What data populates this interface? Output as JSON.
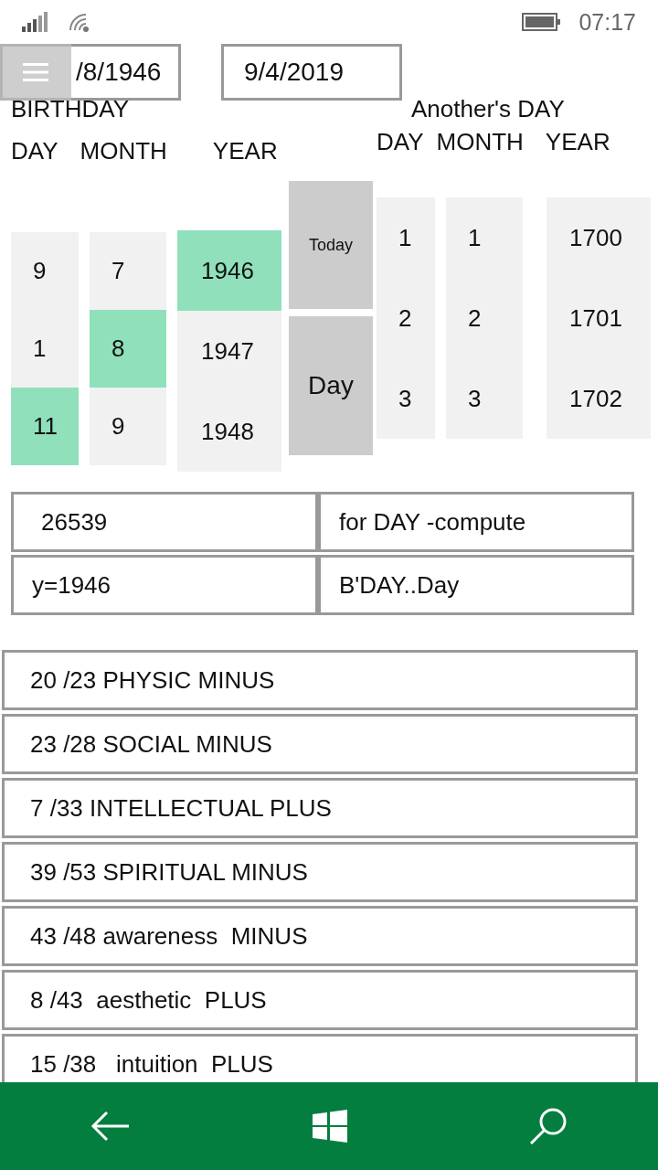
{
  "status_bar": {
    "time": "07:17"
  },
  "fields": {
    "birthday": "/8/1946",
    "another_day": "9/4/2019"
  },
  "birthday_label": "BIRTHDAY",
  "another_label": "Another's DAY",
  "left_headings": [
    "DAY",
    "MONTH",
    "YEAR"
  ],
  "right_headings": [
    "DAY",
    "MONTH",
    "YEAR"
  ],
  "left_pickers": [
    {
      "items": [
        {
          "label": "9",
          "selected": false
        },
        {
          "label": "1",
          "selected": false
        },
        {
          "label": "11",
          "selected": true
        }
      ]
    },
    {
      "items": [
        {
          "label": "7",
          "selected": false
        },
        {
          "label": "8",
          "selected": true
        },
        {
          "label": "9",
          "selected": false
        }
      ]
    },
    {
      "items": [
        {
          "label": "1946",
          "selected": true
        },
        {
          "label": "1947",
          "selected": false
        },
        {
          "label": "1948",
          "selected": false
        }
      ]
    }
  ],
  "buttons": [
    "Today",
    "Day"
  ],
  "right_pickers": [
    {
      "items": [
        {
          "label": "1",
          "selected": false
        },
        {
          "label": "2",
          "selected": false
        },
        {
          "label": "3",
          "selected": false
        }
      ]
    },
    {
      "items": [
        {
          "label": "1",
          "selected": false
        },
        {
          "label": "2",
          "selected": false
        },
        {
          "label": "3",
          "selected": false
        }
      ]
    },
    {
      "items": [
        {
          "label": "1700",
          "selected": false
        },
        {
          "label": "1701",
          "selected": false
        },
        {
          "label": "1702",
          "selected": false
        }
      ]
    }
  ],
  "results": [
    "26539",
    "for DAY -compute",
    "y=1946",
    "B'DAY..Day"
  ],
  "cycles": [
    "20 /23 PHYSIC MINUS",
    "23 /28 SOCIAL MINUS",
    "7 /33 INTELLECTUAL PLUS",
    "39 /53 SPIRITUAL MINUS",
    "43 /48 awareness  MINUS",
    "8 /43  aesthetic  PLUS",
    "15 /38   intuition  PLUS"
  ]
}
